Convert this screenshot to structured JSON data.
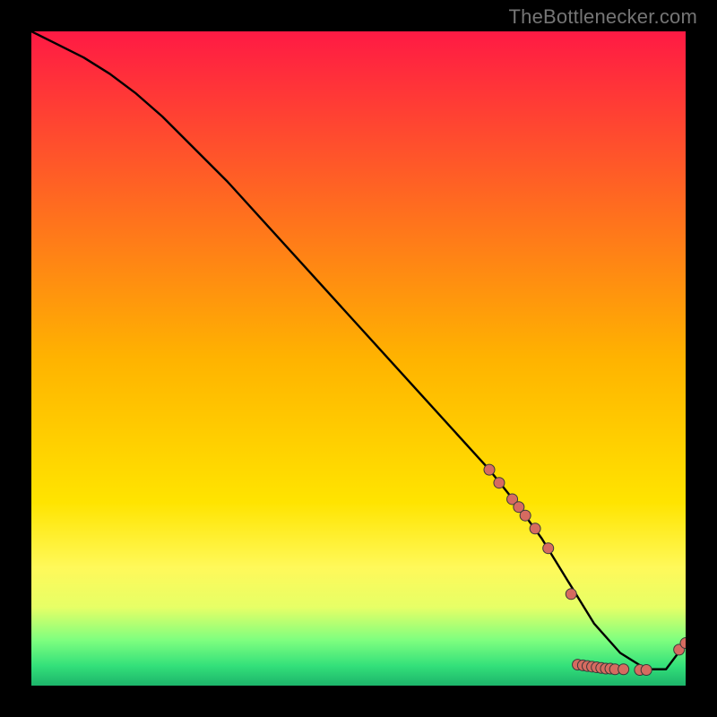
{
  "attribution": "TheBottlenecker.com",
  "chart_data": {
    "type": "line",
    "title": "",
    "xlabel": "",
    "ylabel": "",
    "xlim": [
      0,
      100
    ],
    "ylim": [
      0,
      100
    ],
    "gradient_stops": [
      {
        "offset": 0,
        "color": "#ff1a44"
      },
      {
        "offset": 0.5,
        "color": "#ffb300"
      },
      {
        "offset": 0.72,
        "color": "#ffe400"
      },
      {
        "offset": 0.82,
        "color": "#fff95a"
      },
      {
        "offset": 0.88,
        "color": "#e7ff66"
      },
      {
        "offset": 0.93,
        "color": "#7fff7f"
      },
      {
        "offset": 0.97,
        "color": "#33e07a"
      },
      {
        "offset": 1.0,
        "color": "#1db46a"
      }
    ],
    "series": [
      {
        "name": "curve",
        "x": [
          0,
          4,
          8,
          12,
          16,
          20,
          30,
          40,
          50,
          60,
          70,
          74,
          78,
          82,
          86,
          90,
          94,
          97,
          100
        ],
        "y": [
          100,
          98,
          96,
          93.5,
          90.5,
          87,
          77,
          66,
          55,
          44,
          33,
          28,
          22.5,
          16,
          9.5,
          5,
          2.5,
          2.5,
          6.5
        ]
      }
    ],
    "markers": [
      {
        "x": 70.0,
        "y": 33.0
      },
      {
        "x": 71.5,
        "y": 31.0
      },
      {
        "x": 73.5,
        "y": 28.5
      },
      {
        "x": 74.5,
        "y": 27.3
      },
      {
        "x": 75.5,
        "y": 26.0
      },
      {
        "x": 77.0,
        "y": 24.0
      },
      {
        "x": 79.0,
        "y": 21.0
      },
      {
        "x": 82.5,
        "y": 14.0
      },
      {
        "x": 83.5,
        "y": 3.2
      },
      {
        "x": 84.3,
        "y": 3.1
      },
      {
        "x": 85.0,
        "y": 3.0
      },
      {
        "x": 85.7,
        "y": 2.9
      },
      {
        "x": 86.4,
        "y": 2.8
      },
      {
        "x": 87.1,
        "y": 2.7
      },
      {
        "x": 87.8,
        "y": 2.6
      },
      {
        "x": 88.5,
        "y": 2.6
      },
      {
        "x": 89.2,
        "y": 2.5
      },
      {
        "x": 90.5,
        "y": 2.5
      },
      {
        "x": 93.0,
        "y": 2.4
      },
      {
        "x": 94.0,
        "y": 2.4
      },
      {
        "x": 99.0,
        "y": 5.5
      },
      {
        "x": 100.0,
        "y": 6.5
      }
    ],
    "marker_style": {
      "fill": "#d66b60",
      "stroke": "#3a3a3a",
      "r": 6
    }
  }
}
